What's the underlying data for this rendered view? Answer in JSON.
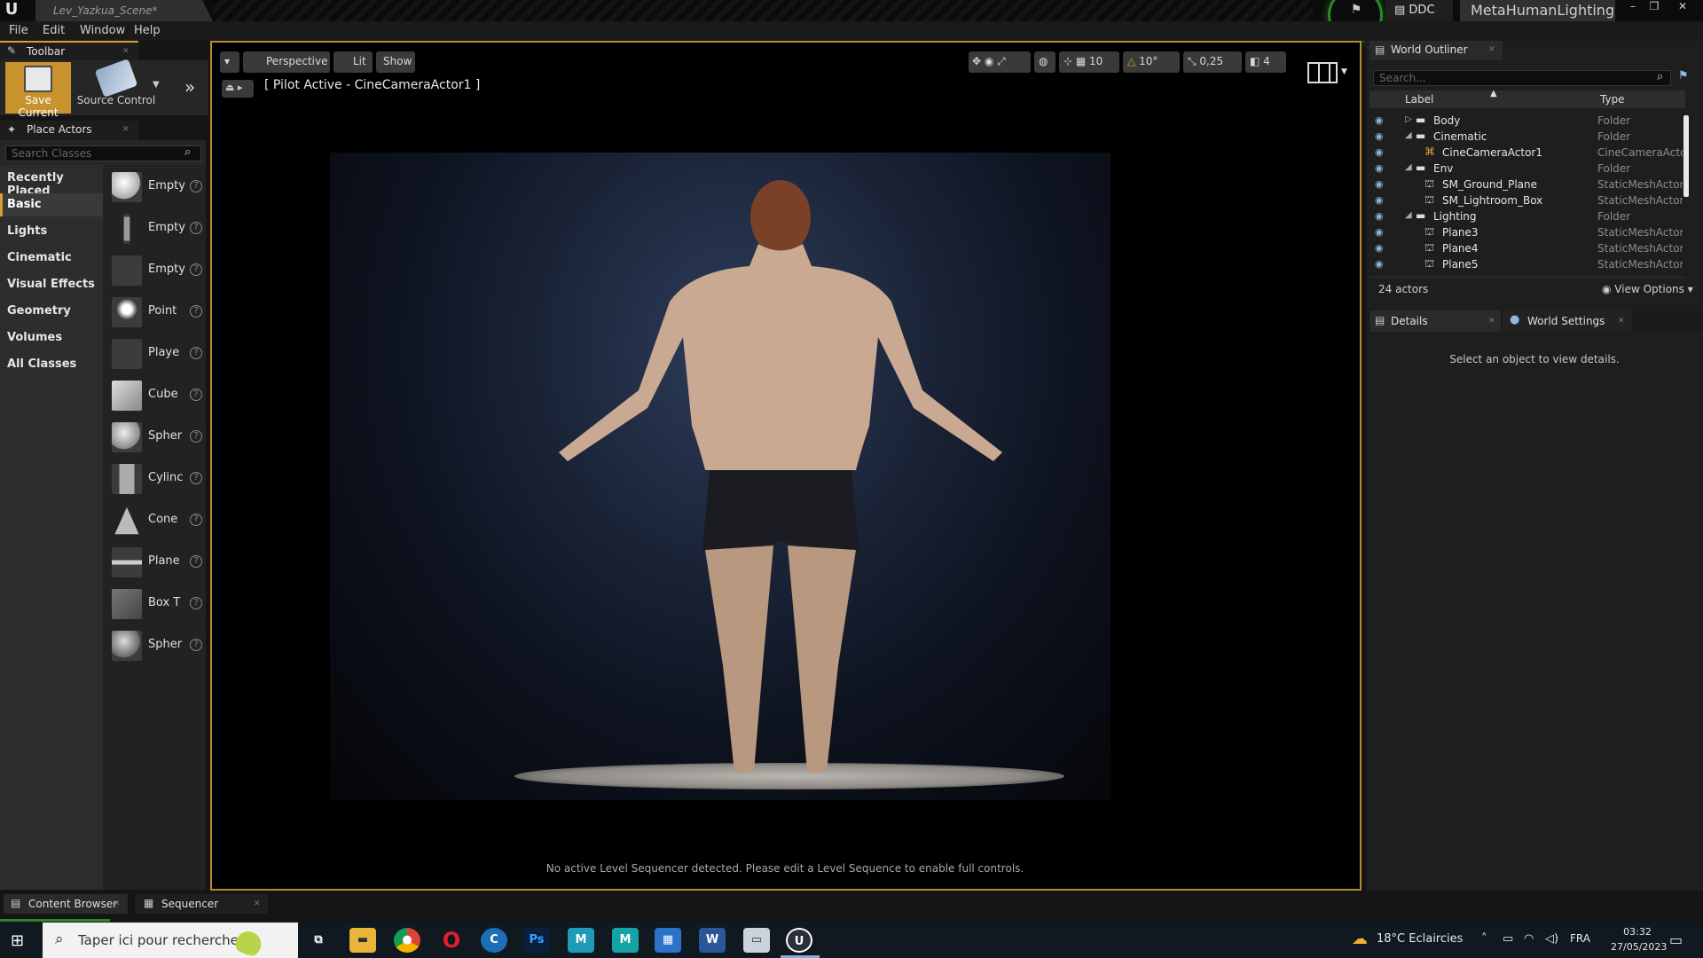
{
  "window": {
    "doc_tab": "Lev_Yazkua_Scene*",
    "ddc": "DDC",
    "project_name": "MetaHumanLighting",
    "controls": [
      "–",
      "❐",
      "✕"
    ]
  },
  "menu": [
    "File",
    "Edit",
    "Window",
    "Help"
  ],
  "toolbar": {
    "tab_label": "Toolbar",
    "save_label": "Save Current",
    "source_control_label": "Source Control"
  },
  "place_actors": {
    "tab_label": "Place Actors",
    "search_placeholder": "Search Classes",
    "categories": [
      "Recently Placed",
      "Basic",
      "Lights",
      "Cinematic",
      "Visual Effects",
      "Geometry",
      "Volumes",
      "All Classes"
    ],
    "active_category": "Basic",
    "actors": [
      "Empty",
      "Empty",
      "Empty",
      "Point",
      "Playe",
      "Cube",
      "Spher",
      "Cylinc",
      "Cone",
      "Plane",
      "Box T",
      "Spher"
    ]
  },
  "viewport": {
    "perspective_label": "Perspective",
    "lit_label": "Lit",
    "show_label": "Show",
    "pilot_label": "[ Pilot Active - CineCameraActor1 ]",
    "grid_snap": "10",
    "rotation_snap": "10°",
    "scale_snap": "0,25",
    "camera_speed": "4",
    "message": "No active Level Sequencer detected. Please edit a Level Sequence to enable full controls."
  },
  "outliner": {
    "tab_label": "World Outliner",
    "search_placeholder": "Search...",
    "col_label": "Label",
    "col_type": "Type",
    "rows": [
      {
        "label": "Body",
        "type": "Folder"
      },
      {
        "label": "Cinematic",
        "type": "Folder"
      },
      {
        "label": "CineCameraActor1",
        "type": "CineCameraActor"
      },
      {
        "label": "Env",
        "type": "Folder"
      },
      {
        "label": "SM_Ground_Plane",
        "type": "StaticMeshActor"
      },
      {
        "label": "SM_Lightroom_Box",
        "type": "StaticMeshActor"
      },
      {
        "label": "Lighting",
        "type": "Folder"
      },
      {
        "label": "Plane3",
        "type": "StaticMeshActor"
      },
      {
        "label": "Plane4",
        "type": "StaticMeshActor"
      },
      {
        "label": "Plane5",
        "type": "StaticMeshActor"
      }
    ],
    "actor_count": "24 actors",
    "view_options": "View Options"
  },
  "details": {
    "details_tab": "Details",
    "world_settings_tab": "World Settings",
    "empty_message": "Select an object to view details."
  },
  "bottom_tabs": {
    "content_browser": "Content Browser",
    "sequencer": "Sequencer"
  },
  "taskbar": {
    "search_placeholder": "Taper ici pour rechercher",
    "weather": "18°C Eclaircies",
    "language": "FRA",
    "time": "03:32",
    "date": "27/05/2023",
    "apps": [
      "task-view",
      "file-explorer",
      "chrome",
      "opera",
      "cinema4d",
      "photoshop",
      "maya",
      "metahuman",
      "calculator",
      "word",
      "unknown-app",
      "unreal-engine"
    ]
  },
  "colors": {
    "accent": "#d6a036",
    "viewport_border": "#b8892e",
    "taskbar": "#101820"
  }
}
